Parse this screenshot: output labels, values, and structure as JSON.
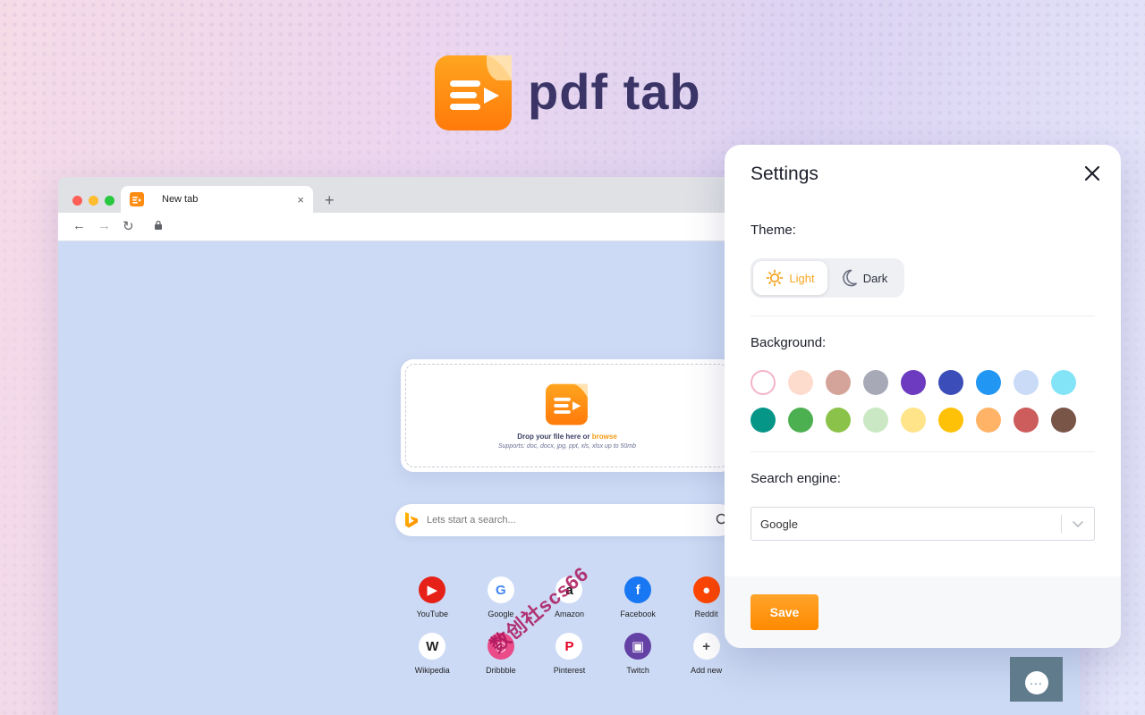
{
  "brand": {
    "name": "pdf tab",
    "logo_icon": "pdf-tab-logo-icon"
  },
  "browser": {
    "tab_title": "New tab",
    "tab_close": "×",
    "new_tab": "+",
    "nav": {
      "back": "←",
      "forward": "→",
      "reload": "↻"
    }
  },
  "dropzone": {
    "text": "Drop your file here or",
    "browse": "browse",
    "supports": "Supports: doc, docx, jpg, ppt, xls, xlsx up to 50mb"
  },
  "search": {
    "placeholder": "Lets start a search...",
    "engine_icon": "bing-icon"
  },
  "shortcuts": [
    {
      "label": "YouTube",
      "glyph": "▶",
      "color": "#e62117",
      "fg": "#ffffff"
    },
    {
      "label": "Google",
      "glyph": "G",
      "color": "#ffffff",
      "fg": "#4285f4"
    },
    {
      "label": "Amazon",
      "glyph": "a",
      "color": "#ffffff",
      "fg": "#111111"
    },
    {
      "label": "Facebook",
      "glyph": "f",
      "color": "#1877f2",
      "fg": "#ffffff"
    },
    {
      "label": "Reddit",
      "glyph": "●",
      "color": "#ff4500",
      "fg": "#ffffff"
    },
    {
      "label": "Wikipedia",
      "glyph": "W",
      "color": "#ffffff",
      "fg": "#222222"
    },
    {
      "label": "Dribbble",
      "glyph": "◎",
      "color": "#ea4c89",
      "fg": "#ffffff"
    },
    {
      "label": "Pinterest",
      "glyph": "P",
      "color": "#ffffff",
      "fg": "#e60023"
    },
    {
      "label": "Twitch",
      "glyph": "▣",
      "color": "#6441a5",
      "fg": "#ffffff"
    },
    {
      "label": "Add new",
      "glyph": "+",
      "color": "#ffffff",
      "fg": "#444444"
    }
  ],
  "settings": {
    "title": "Settings",
    "theme_label": "Theme:",
    "theme_light": "Light",
    "theme_dark": "Dark",
    "background_label": "Background:",
    "swatches": [
      "#ffffff",
      "#fddccd",
      "#d4a49a",
      "#a7aab6",
      "#6c3bbf",
      "#3b4db8",
      "#2196f3",
      "#c9dbf7",
      "#84e4f7",
      "#069688",
      "#4caf50",
      "#8bc34a",
      "#c9e8c3",
      "#ffe48a",
      "#ffc107",
      "#ffb366",
      "#cd5c5c",
      "#795548"
    ],
    "selected_swatch": 0,
    "search_engine_label": "Search engine:",
    "search_engine_value": "Google",
    "save_label": "Save"
  },
  "chat": {
    "glyph": "..."
  },
  "watermark": "数创社scs66"
}
